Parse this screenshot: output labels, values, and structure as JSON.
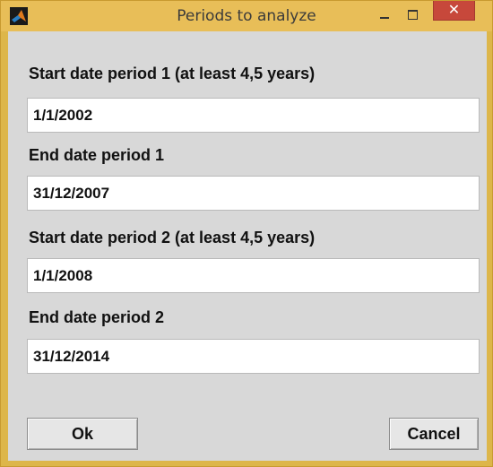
{
  "window": {
    "title": "Periods to analyze",
    "controls": {
      "minimize": "minimize-icon",
      "maximize": "maximize-icon",
      "close": "close-icon"
    }
  },
  "form": {
    "start1": {
      "label": "Start date period 1 (at least 4,5 years)",
      "value": "1/1/2002"
    },
    "end1": {
      "label": "End date period 1",
      "value": "31/12/2007"
    },
    "start2": {
      "label": "Start date period 2 (at least 4,5 years)",
      "value": "1/1/2008"
    },
    "end2": {
      "label": "End date period 2",
      "value": "31/12/2014"
    }
  },
  "buttons": {
    "ok": "Ok",
    "cancel": "Cancel"
  },
  "colors": {
    "title_bar": "#e8be58",
    "close_button": "#c7483b",
    "dialog_background": "#d8d8d8"
  }
}
